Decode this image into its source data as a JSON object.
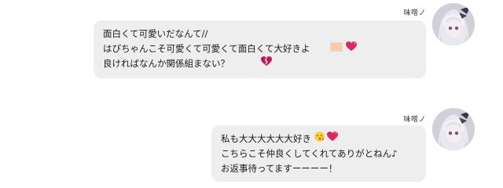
{
  "messages": [
    {
      "sender": "味噌ノ",
      "lines": [
        "面白くて可愛いだなんて//",
        "はぴちゃんこそ可愛くて可愛くて面白くて大好きよ",
        "良ければなんか関係組まない？"
      ]
    },
    {
      "sender": "味噌ノ",
      "lines": [
        "私も大大大大大大好き",
        "こちらこそ仲良くしてくれてありがとねん♪",
        "お返事待ってますーーーー！"
      ]
    }
  ],
  "icons": {
    "hand": "raised-hand-icon",
    "heart": "sparkling-heart-icon",
    "broken_heart": "broken-heart-icon",
    "kiss": "face-blowing-kiss-icon"
  },
  "colors": {
    "bubble": "#eeeeee",
    "text": "#1a1a1a",
    "heart": "#e0245e"
  }
}
